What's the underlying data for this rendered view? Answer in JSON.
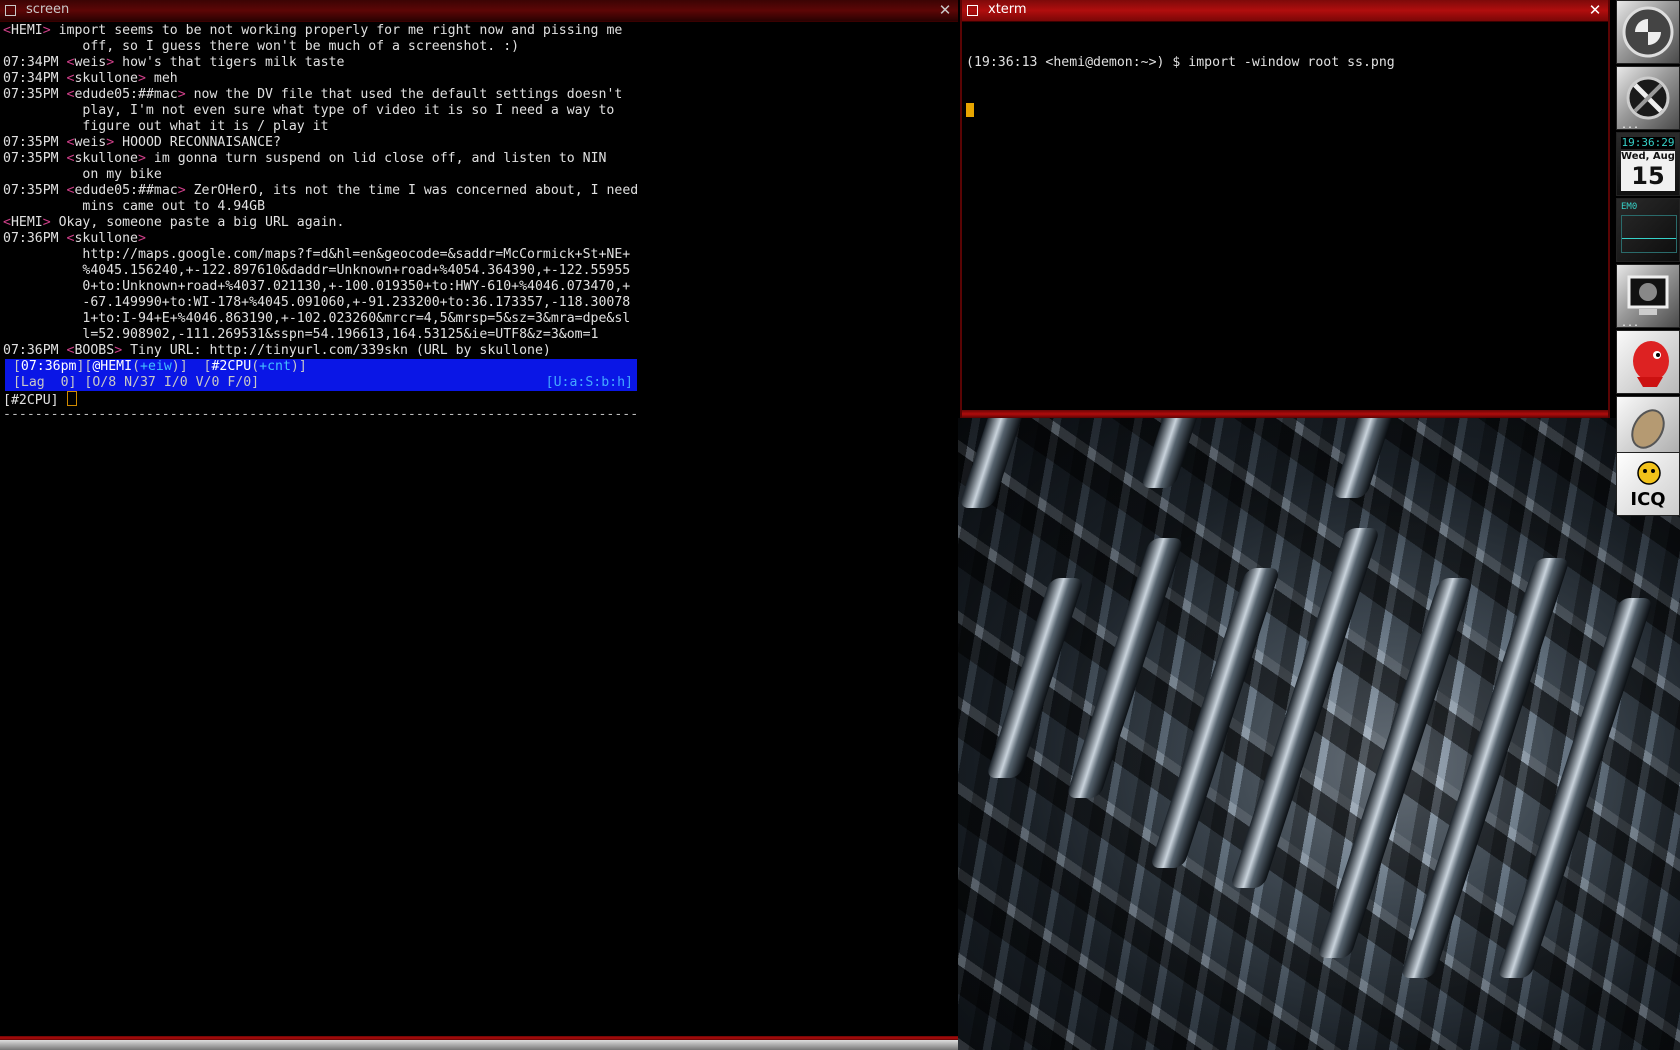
{
  "screen_window": {
    "title": "screen",
    "lines": [
      {
        "ts": "",
        "nick": "HEMI",
        "text": " import seems to be not working properly for me right now and pissing me"
      },
      {
        "ts": "",
        "nick": "",
        "text": "          off, so I guess there won't be much of a screenshot. :)"
      },
      {
        "ts": "07:34PM ",
        "nick": "weis",
        "text": " how's that tigers milk taste"
      },
      {
        "ts": "07:34PM ",
        "nick": "skullone",
        "text": " meh"
      },
      {
        "ts": "07:35PM ",
        "nick": "edude05:##mac",
        "text": " now the DV file that used the default settings doesn't"
      },
      {
        "ts": "",
        "nick": "",
        "text": "          play, I'm not even sure what type of video it is so I need a way to"
      },
      {
        "ts": "",
        "nick": "",
        "text": "          figure out what it is / play it"
      },
      {
        "ts": "07:35PM ",
        "nick": "weis",
        "text": " HOOOD RECONNAISANCE?"
      },
      {
        "ts": "07:35PM ",
        "nick": "skullone",
        "text": " im gonna turn suspend on lid close off, and listen to NIN"
      },
      {
        "ts": "",
        "nick": "",
        "text": "          on my bike"
      },
      {
        "ts": "07:35PM ",
        "nick": "edude05:##mac",
        "text": " ZerOHerO, its not the time I was concerned about, I need"
      },
      {
        "ts": "",
        "nick": "",
        "text": "          mins came out to 4.94GB"
      },
      {
        "ts": "",
        "nick": "HEMI",
        "text": " Okay, someone paste a big URL again."
      },
      {
        "ts": "07:36PM ",
        "nick": "skullone",
        "text": ""
      },
      {
        "ts": "",
        "nick": "",
        "text": "          http://maps.google.com/maps?f=d&hl=en&geocode=&saddr=McCormick+St+NE+"
      },
      {
        "ts": "",
        "nick": "",
        "text": "          %4045.156240,+-122.897610&daddr=Unknown+road+%4054.364390,+-122.55955"
      },
      {
        "ts": "",
        "nick": "",
        "text": "          0+to:Unknown+road+%4037.021130,+-100.019350+to:HWY-610+%4046.073470,+"
      },
      {
        "ts": "",
        "nick": "",
        "text": "          -67.149990+to:WI-178+%4045.091060,+-91.233200+to:36.173357,-118.30078"
      },
      {
        "ts": "",
        "nick": "",
        "text": "          1+to:I-94+E+%4046.863190,+-102.023260&mrcr=4,5&mrsp=5&sz=3&mra=dpe&sl"
      },
      {
        "ts": "",
        "nick": "",
        "text": "          l=52.908902,-111.269531&sspn=54.196613,164.53125&ie=UTF8&z=3&om=1"
      },
      {
        "ts": "07:36PM ",
        "nick": "BOOBS",
        "text": " Tiny URL: http://tinyurl.com/339skn (URL by skullone)"
      }
    ],
    "status1": {
      "time": "07:36pm",
      "nick": "@HEMI",
      "nick_mode": "+eiw",
      "channel": "#2CPU",
      "chan_mode": "+cnt"
    },
    "status2": {
      "lag": "Lag  0",
      "counts": "O/8 N/37 I/0 V/0 F/0",
      "right": "U:a:S:b:h"
    },
    "prompt": "[#2CPU]",
    "separator": "--------------------------------------------------------------------------------"
  },
  "xterm_window": {
    "title": "xterm",
    "command_line": "(19:36:13 <hemi@demon:~>) $ import -window root ss.png"
  },
  "dock": {
    "clock_time": "19:36:29",
    "clock_day_of_week": "Wed, Aug",
    "clock_day": "15",
    "monitor_label": "EM0"
  },
  "colors": {
    "titlebar_red": "#b10e0e",
    "status_blue": "#0a16e6",
    "nick_bracket": "#d0408a",
    "cursor_orange": "#e7a500"
  }
}
